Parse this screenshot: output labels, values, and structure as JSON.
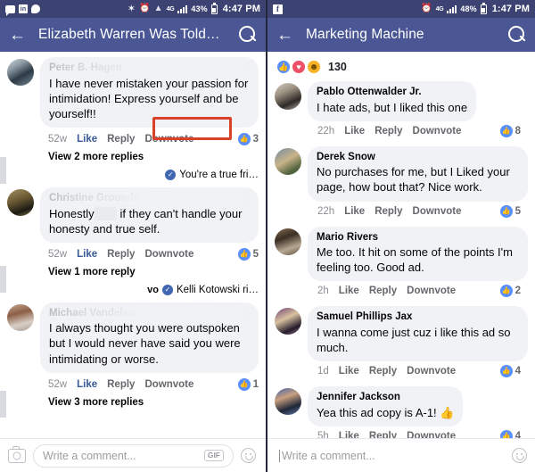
{
  "left": {
    "statusbar": {
      "icons": [
        "messenger-icon",
        "linkedin-icon",
        "chat-bubble-icon"
      ],
      "bluetooth": "✶",
      "alarm": "⏰",
      "wifi": "▲",
      "network": "4G",
      "battery_pct": "43%",
      "time": "4:47 PM"
    },
    "header": {
      "back": "←",
      "title": "Elizabeth Warren Was Told…",
      "search": "search-icon"
    },
    "comments": [
      {
        "name": "Peter B. Hagen",
        "redacted": true,
        "text": "I have never mistaken your passion for intimidation! Express yourself and be yourself!!",
        "time": "52w",
        "like": "Like",
        "reply": "Reply",
        "downvote": "Downvote",
        "count": "3",
        "view_more": "View 2 more replies",
        "highlight": true
      },
      {
        "name": "Christine Grounds",
        "redacted": true,
        "text_before": "Honestly",
        "text_redacted": "       ",
        "text_after": "if they can't handle your honesty and true self.",
        "time": "52w",
        "like": "Like",
        "reply": "Reply",
        "downvote": "Downvote",
        "count": "5",
        "view_more": "View 1 more reply",
        "peek_prefix": "",
        "peek_text": "You're a true fri…"
      },
      {
        "name": "Michael Vandelaar",
        "redacted": true,
        "text": "I always thought you were outspoken but I would never have said you were intimidating or worse.",
        "time": "52w",
        "like": "Like",
        "reply": "Reply",
        "downvote": "Downvote",
        "count": "1",
        "view_more": "View 3 more replies",
        "peek_prefix": "vo",
        "peek_text": "Kelli Kotowski ri…"
      }
    ],
    "composer": {
      "camera": "camera-icon",
      "placeholder": "Write a comment...",
      "gif": "GIF",
      "emoji": "smiley-icon"
    }
  },
  "right": {
    "statusbar": {
      "icons": [
        "facebook-icon"
      ],
      "alarm": "⏰",
      "network": "4G",
      "battery_pct": "48%",
      "time": "1:47 PM"
    },
    "header": {
      "back": "←",
      "title": "Marketing Machine",
      "search": "search-icon"
    },
    "reactions": {
      "types": [
        "like",
        "love",
        "haha"
      ],
      "like_glyph": "👍",
      "love_glyph": "♥",
      "haha_glyph": "☻",
      "count": "130"
    },
    "comments": [
      {
        "name": "Pablo Ottenwalder Jr.",
        "text": "I hate ads, but I liked this one",
        "time": "22h",
        "like": "Like",
        "reply": "Reply",
        "downvote": "Downvote",
        "count": "8"
      },
      {
        "name": "Derek Snow",
        "text": "No purchases for me, but I Liked your page, how bout that? Nice work.",
        "time": "22h",
        "like": "Like",
        "reply": "Reply",
        "downvote": "Downvote",
        "count": "5"
      },
      {
        "name": "Mario Rivers",
        "text": "Me too. It hit on some of the points I'm feeling too. Good ad.",
        "time": "2h",
        "like": "Like",
        "reply": "Reply",
        "downvote": "Downvote",
        "count": "2"
      },
      {
        "name": "Samuel Phillips Jax",
        "text": "I wanna come just cuz i like this ad so much.",
        "time": "1d",
        "like": "Like",
        "reply": "Reply",
        "downvote": "Downvote",
        "count": "4"
      },
      {
        "name": "Jennifer Jackson",
        "text": "Yea this ad copy is A-1! 👍",
        "time": "5h",
        "like": "Like",
        "reply": "Reply",
        "downvote": "Downvote",
        "count": "4"
      }
    ],
    "composer": {
      "placeholder": "Write a comment...",
      "emoji": "smiley-icon"
    }
  },
  "colors": {
    "status_bar": "#3c4373",
    "header": "#4a5794",
    "bubble": "#f0f2f5",
    "highlight": "#d9412b",
    "link_blue": "#385898",
    "like_blue": "#5890ff",
    "love_red": "#ed5167",
    "haha_yellow": "#f7b125"
  }
}
